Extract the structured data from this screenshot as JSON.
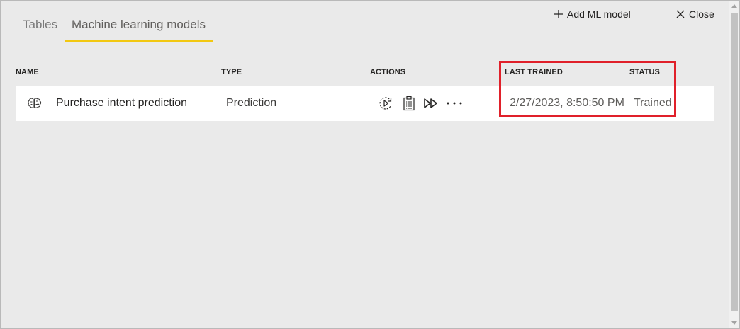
{
  "tabs": [
    {
      "label": "Tables",
      "active": false
    },
    {
      "label": "Machine learning models",
      "active": true
    }
  ],
  "toolbar": {
    "add_label": "Add ML model",
    "close_label": "Close"
  },
  "columns": {
    "name": "NAME",
    "type": "TYPE",
    "actions": "ACTIONS",
    "last_trained": "LAST TRAINED",
    "status": "STATUS"
  },
  "rows": [
    {
      "name": "Purchase intent prediction",
      "type": "Prediction",
      "last_trained": "2/27/2023, 8:50:50 PM",
      "status": "Trained",
      "icon": "brain-icon",
      "actions": [
        "retrain-icon",
        "report-icon",
        "apply-model-icon",
        "more-icon"
      ]
    }
  ],
  "colors": {
    "accent": "#f2c811",
    "highlight": "#e0202a",
    "background": "#eaeaea",
    "row_background": "#ffffff"
  }
}
